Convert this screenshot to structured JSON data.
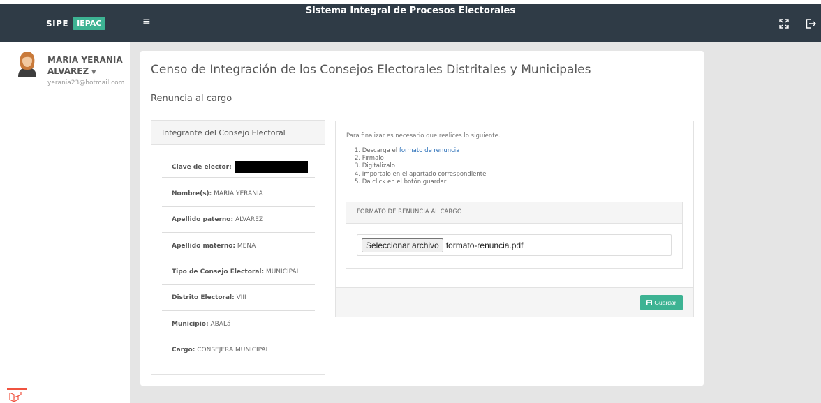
{
  "header": {
    "brand_sipe": "SIPE",
    "brand_iepac": "IEPAC",
    "menu_icon": "≡",
    "app_title": "Sistema Integral de Procesos Electorales",
    "icons": [
      "expand-icon",
      "logout-icon"
    ]
  },
  "user": {
    "name_line1": "MARIA YERANIA",
    "name_line2": "ALVAREZ",
    "email": "yerania23@hotmail.com"
  },
  "page": {
    "title": "Censo de Integración de los Consejos Electorales Distritales y Municipales",
    "section_title": "Renuncia al cargo"
  },
  "member": {
    "heading": "Integrante del Consejo Electoral",
    "fields": [
      {
        "label": "Clave de elector:",
        "value": ""
      },
      {
        "label": "Nombre(s):",
        "value": "MARIA YERANIA"
      },
      {
        "label": "Apellido paterno:",
        "value": "ALVAREZ"
      },
      {
        "label": "Apellido materno:",
        "value": "MENA"
      },
      {
        "label": "Tipo de Consejo Electoral:",
        "value": "MUNICIPAL"
      },
      {
        "label": "Distrito Electoral:",
        "value": "VIII"
      },
      {
        "label": "Municipio:",
        "value": "ABALá"
      },
      {
        "label": "Cargo:",
        "value": "CONSEJERA MUNICIPAL"
      }
    ]
  },
  "upload": {
    "instructions": "Para finalizar es necesario que realices lo siguiente.",
    "step1_prefix": "1. Descarga el ",
    "step1_link": "formato de renuncia",
    "step2": "2. Firmalo",
    "step3": "3. Digitalizalo",
    "step4": "4. Importalo en el apartado correspondiente",
    "step5": "5. Da click en el botón guardar",
    "format_heading": "FORMATO DE RENUNCIA AL CARGO",
    "file_button": "Seleccionar archivo",
    "file_name": "formato-renuncia.pdf",
    "save_label": "Guardar"
  },
  "colors": {
    "topbar": "#2f3b46",
    "accent": "#3db393",
    "link": "#2a6fb8"
  }
}
